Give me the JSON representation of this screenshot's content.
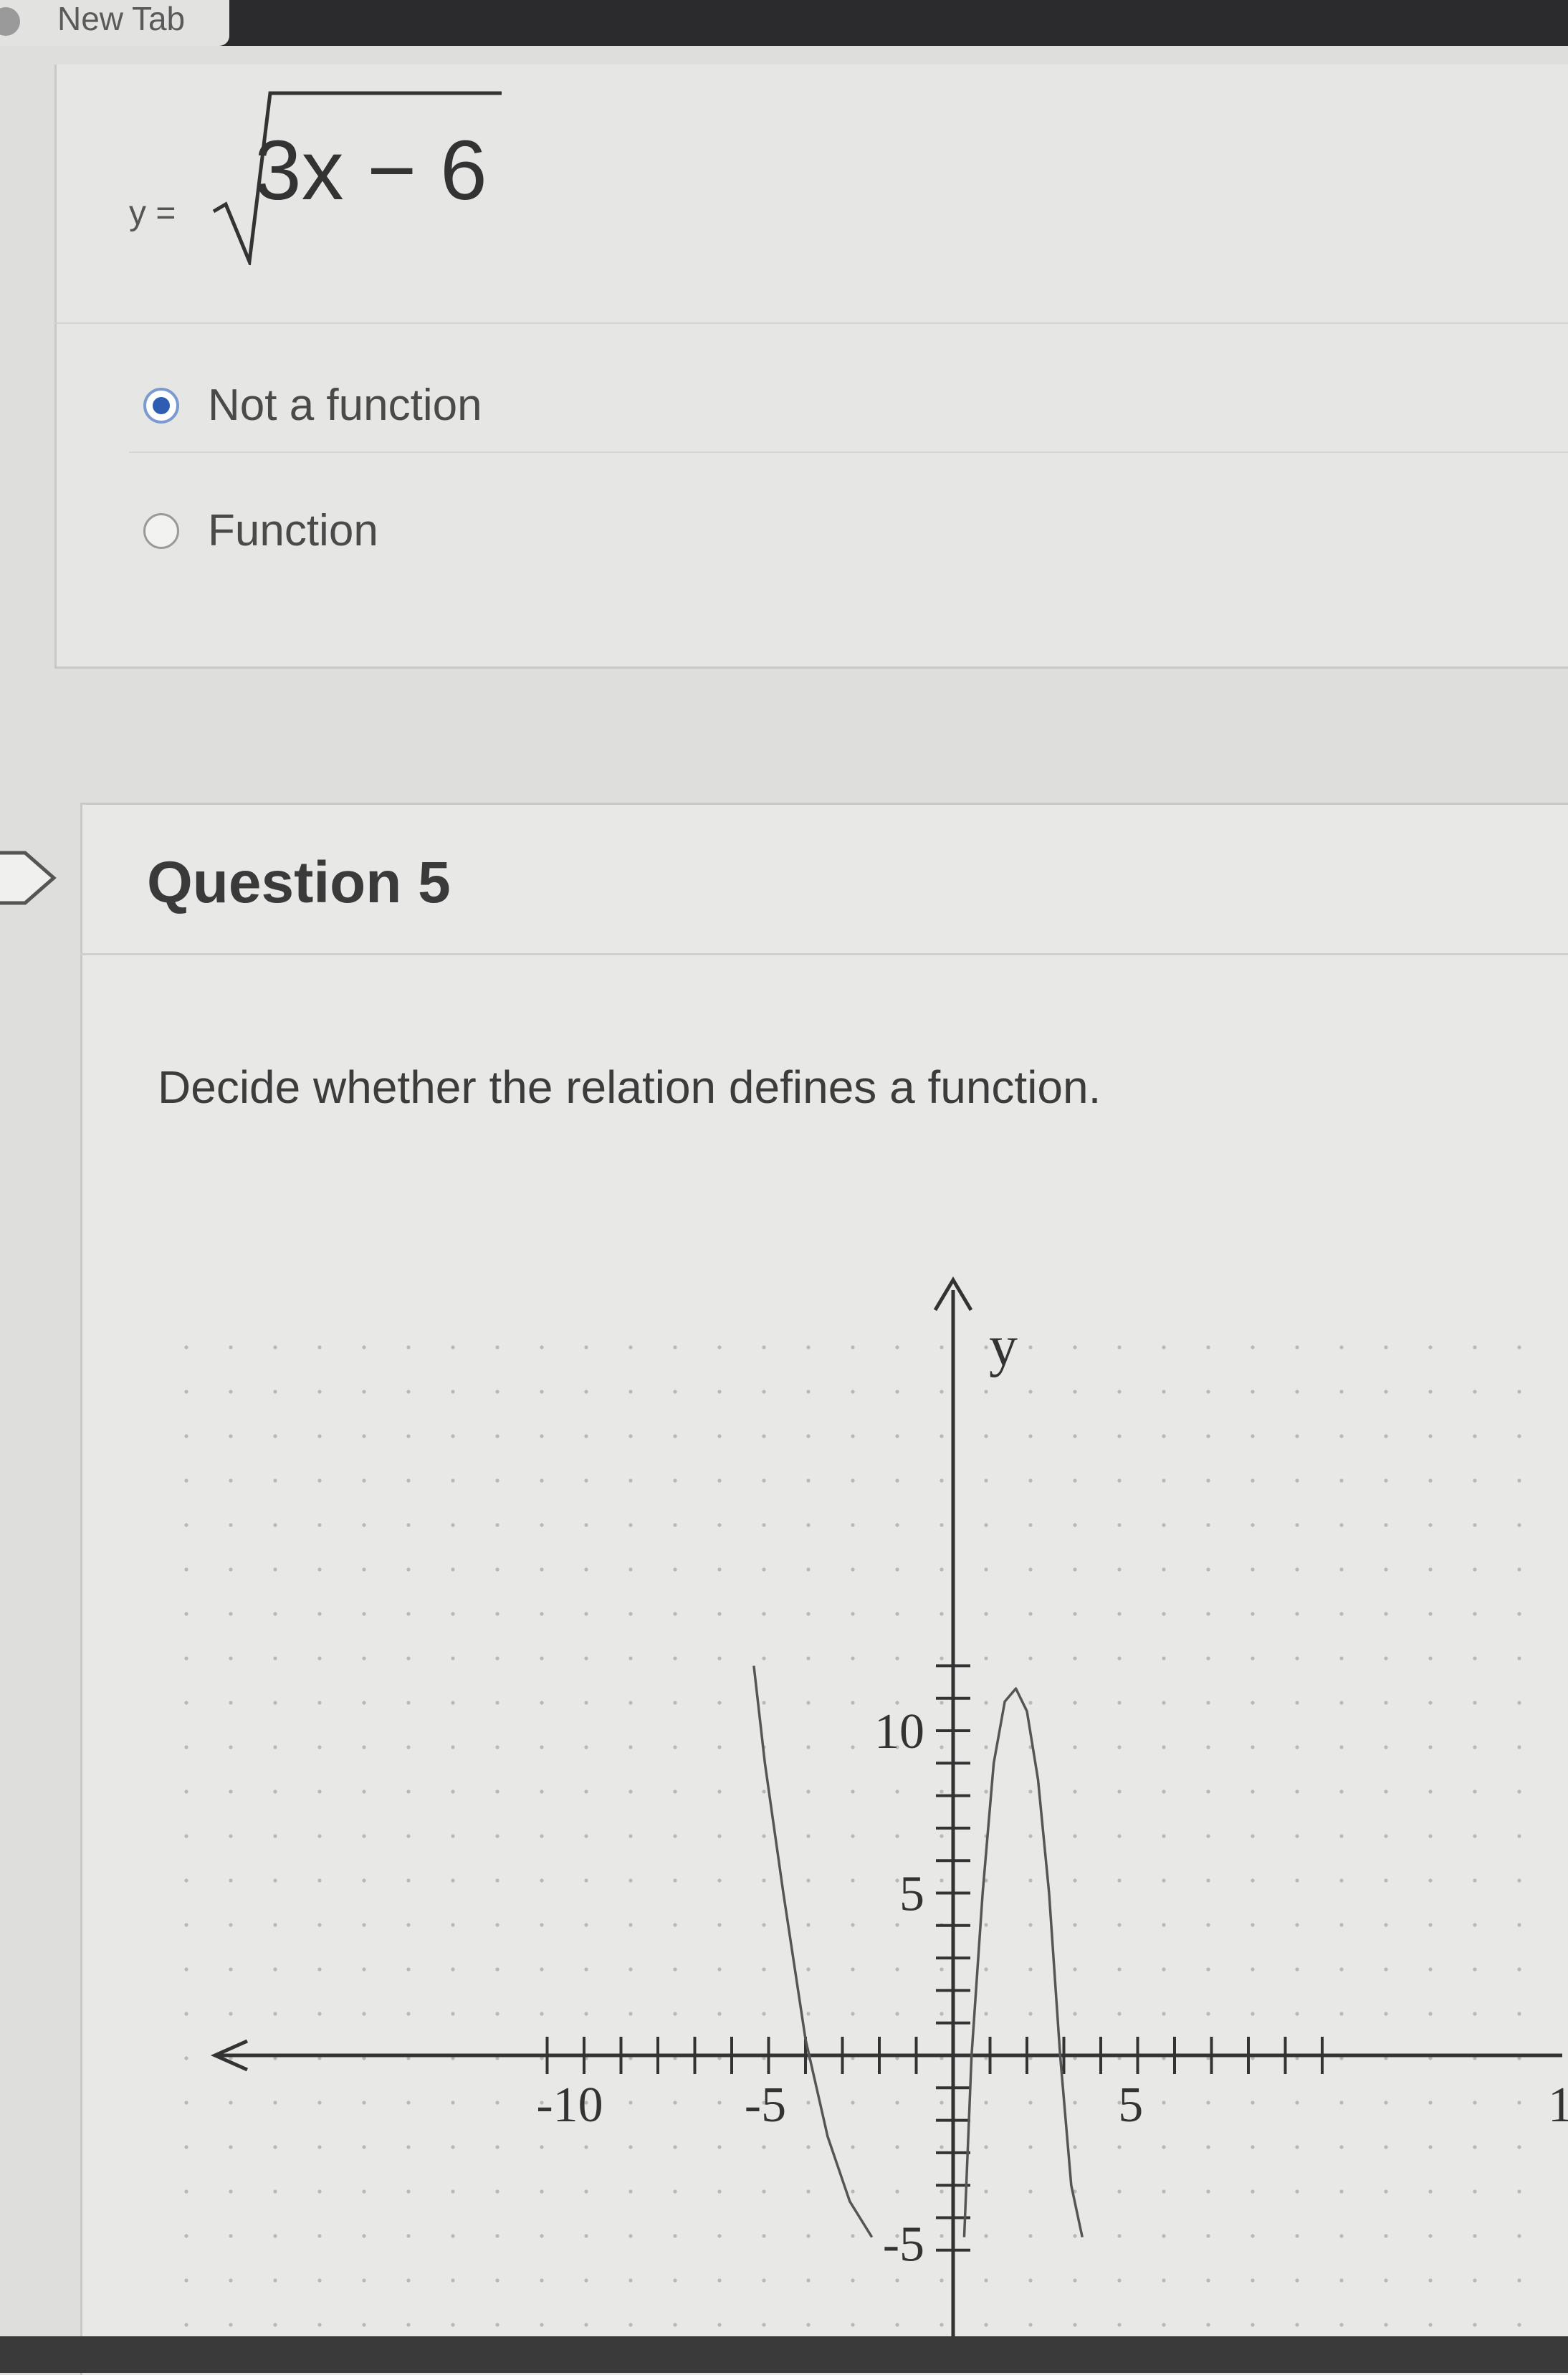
{
  "browser": {
    "tab_title": "New Tab"
  },
  "previous_question": {
    "equation_lhs": "y =",
    "equation_radicand": "3x − 6",
    "options": [
      {
        "label": "Not a function",
        "selected": true
      },
      {
        "label": "Function",
        "selected": false
      }
    ]
  },
  "question": {
    "title": "Question 5",
    "prompt": "Decide whether the relation defines a function."
  },
  "chart_data": {
    "type": "line",
    "ylabel": "y",
    "x_ticks": [
      "-10",
      "-5",
      "5",
      "1"
    ],
    "y_ticks": [
      "10",
      "5",
      "-5"
    ],
    "xlim": [
      -11,
      10
    ],
    "ylim": [
      -5,
      12
    ],
    "series": [
      {
        "x": [
          -5.4,
          -5.1,
          -4.6,
          -4.0,
          -3.4,
          -2.8,
          -2.2
        ],
        "y": [
          12,
          9,
          5,
          0.5,
          -2.5,
          -4.5,
          -5.6
        ]
      },
      {
        "x": [
          0.3,
          0.5,
          0.8,
          1.1,
          1.4,
          1.7,
          2.0,
          2.3,
          2.6,
          2.9,
          3.2,
          3.5
        ],
        "y": [
          -5.6,
          0,
          5,
          9,
          10.9,
          11.3,
          10.6,
          8.5,
          5,
          0,
          -4,
          -5.6
        ]
      }
    ]
  }
}
